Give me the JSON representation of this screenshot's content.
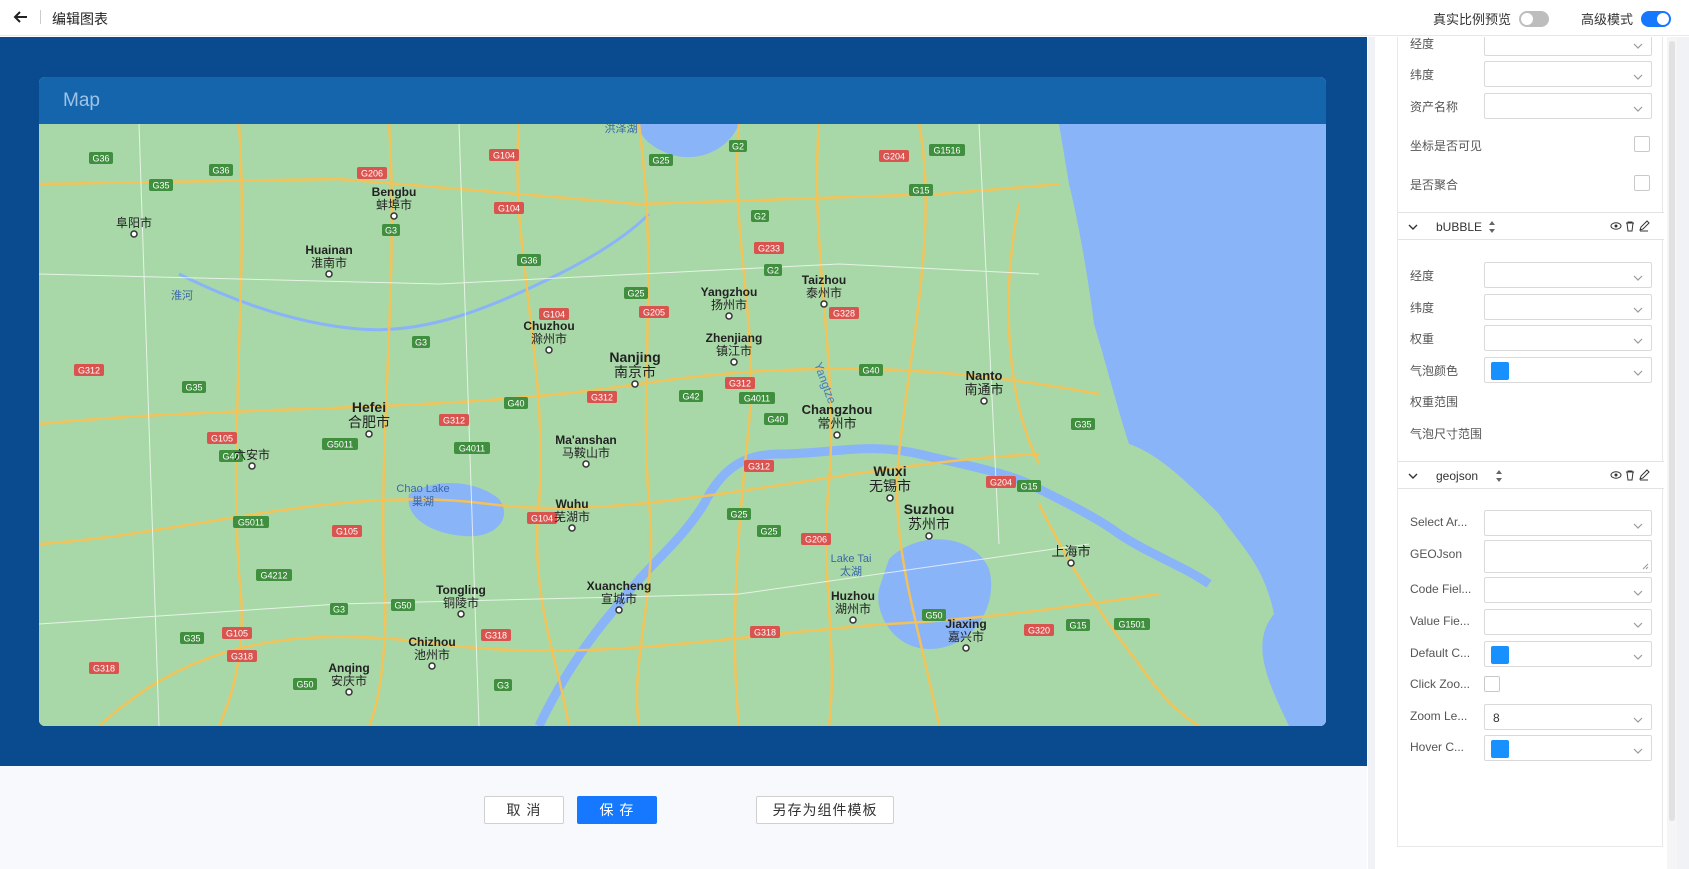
{
  "header": {
    "title": "编辑图表",
    "toggle1_label": "真实比例预览",
    "toggle1_on": false,
    "toggle2_label": "高级模式",
    "toggle2_on": true
  },
  "card": {
    "title": "Map"
  },
  "map": {
    "cities": [
      {
        "en": "Nanjing",
        "zh": "南京市"
      },
      {
        "en": "Hefei",
        "zh": "合肥市"
      },
      {
        "en": "Changzhou",
        "zh": "常州市"
      },
      {
        "en": "Wuxi",
        "zh": "无锡市"
      },
      {
        "en": "Suzhou",
        "zh": "苏州市"
      },
      {
        "en": "",
        "zh": "上海市"
      },
      {
        "en": "Nanto",
        "zh": "南通市"
      },
      {
        "en": "Yangzhou",
        "zh": "扬州市"
      },
      {
        "en": "Zhenjiang",
        "zh": "镇江市"
      },
      {
        "en": "Taizhou",
        "zh": "泰州市"
      },
      {
        "en": "Chuzhou",
        "zh": "滁州市"
      },
      {
        "en": "Bengbu",
        "zh": "蚌埠市"
      },
      {
        "en": "Huainan",
        "zh": "淮南市"
      },
      {
        "en": "",
        "zh": "阜阳市"
      },
      {
        "en": "",
        "zh": "六安市"
      },
      {
        "en": "Ma'anshan",
        "zh": "马鞍山市"
      },
      {
        "en": "Wuhu",
        "zh": "芜湖市"
      },
      {
        "en": "Xuancheng",
        "zh": "宣城市"
      },
      {
        "en": "Tongling",
        "zh": "铜陵市"
      },
      {
        "en": "Chizhou",
        "zh": "池州市"
      },
      {
        "en": "Anqing",
        "zh": "安庆市"
      },
      {
        "en": "Huzhou",
        "zh": "湖州市"
      },
      {
        "en": "Jiaxing",
        "zh": "嘉兴市"
      }
    ],
    "lakes": [
      {
        "en": "Chao Lake",
        "zh": "巢湖"
      },
      {
        "en": "Lake Tai",
        "zh": "太湖"
      },
      {
        "en": "",
        "zh": "洪泽湖"
      },
      {
        "en": "",
        "zh": "淮河"
      }
    ],
    "river": "Yangtze",
    "roads": [
      "G36",
      "G36",
      "G35",
      "G206",
      "G104",
      "G25",
      "G2",
      "G204",
      "G1516",
      "G15",
      "G3",
      "G104",
      "G2",
      "G233",
      "G2",
      "G25",
      "G205",
      "G328",
      "G36",
      "G104",
      "G3",
      "G312",
      "G35",
      "G40",
      "G312",
      "G42",
      "G4011",
      "G312",
      "G40",
      "G40",
      "G105",
      "G40",
      "G312",
      "G5011",
      "G4011",
      "G312",
      "G204",
      "G15",
      "G35",
      "G5011",
      "G104",
      "G25",
      "G25",
      "G206",
      "G105",
      "G4212",
      "G3",
      "G50",
      "G318",
      "G35",
      "G105",
      "G318",
      "G50",
      "G318",
      "G318",
      "G50",
      "G320",
      "G15",
      "G1501",
      "G3"
    ]
  },
  "footer": {
    "cancel": "取 消",
    "save": "保 存",
    "save_template": "另存为组件模板"
  },
  "panel": {
    "top_fields": [
      {
        "label": "经度",
        "type": "select",
        "value": ""
      },
      {
        "label": "纬度",
        "type": "select",
        "value": ""
      },
      {
        "label": "资产名称",
        "type": "select",
        "value": ""
      },
      {
        "label": "坐标是否可见",
        "type": "checkbox"
      },
      {
        "label": "是否聚合",
        "type": "checkbox"
      }
    ],
    "bubble": {
      "name": "bUBBLE",
      "fields": [
        {
          "label": "经度",
          "type": "select",
          "value": ""
        },
        {
          "label": "纬度",
          "type": "select",
          "value": ""
        },
        {
          "label": "权重",
          "type": "select",
          "value": ""
        },
        {
          "label": "气泡颜色",
          "type": "color",
          "color": "#1890ff"
        },
        {
          "label": "权重范围",
          "type": "text"
        },
        {
          "label": "气泡尺寸范围",
          "type": "text"
        }
      ]
    },
    "geojson": {
      "name": "geojson",
      "fields": [
        {
          "label": "Select Ar...",
          "type": "select",
          "value": ""
        },
        {
          "label": "GEOJson",
          "type": "textarea",
          "value": ""
        },
        {
          "label": "Code Fiel...",
          "type": "select",
          "value": ""
        },
        {
          "label": "Value Fie...",
          "type": "select",
          "value": ""
        },
        {
          "label": "Default C...",
          "type": "color",
          "color": "#1890ff"
        },
        {
          "label": "Click Zoo...",
          "type": "checkbox"
        },
        {
          "label": "Zoom Le...",
          "type": "select",
          "value": "8"
        },
        {
          "label": "Hover C...",
          "type": "color",
          "color": "#1890ff"
        }
      ]
    }
  },
  "colors": {
    "canvas_bg": "#0a4a8f",
    "card_head": "#1565ad",
    "primary": "#1677ff",
    "land": "#a8d8a8",
    "sea": "#8ab4f8",
    "road": "#f6c254"
  }
}
